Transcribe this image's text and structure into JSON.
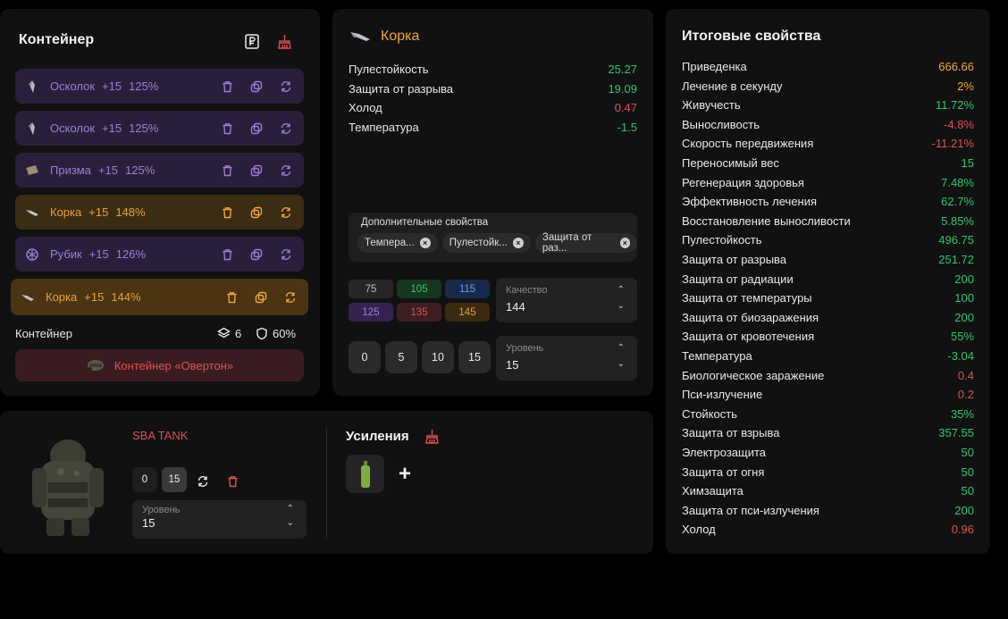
{
  "container_panel": {
    "title": "Контейнер",
    "items": [
      {
        "name": "Осколок",
        "level": "+15",
        "percent": "125%",
        "color": "purple",
        "icon": "shard-icon"
      },
      {
        "name": "Осколок",
        "level": "+15",
        "percent": "125%",
        "color": "purple",
        "icon": "shard-icon"
      },
      {
        "name": "Призма",
        "level": "+15",
        "percent": "125%",
        "color": "purple",
        "icon": "prism-icon"
      },
      {
        "name": "Корка",
        "level": "+15",
        "percent": "148%",
        "color": "orange",
        "icon": "crust-icon"
      },
      {
        "name": "Рубик",
        "level": "+15",
        "percent": "126%",
        "color": "purple",
        "icon": "rubik-icon"
      },
      {
        "name": "Корка",
        "level": "+15",
        "percent": "144%",
        "color": "orange",
        "icon": "crust-icon"
      }
    ],
    "footer": {
      "label": "Контейнер",
      "slots": "6",
      "protection": "60%"
    },
    "container_name": "Контейнер «Овертон»"
  },
  "artifact_panel": {
    "title": "Корка",
    "stats": [
      {
        "name": "Пулестойкость",
        "value": "25.27",
        "color": "green"
      },
      {
        "name": "Защита от разрыва",
        "value": "19.09",
        "color": "green"
      },
      {
        "name": "Холод",
        "value": "0.47",
        "color": "red"
      },
      {
        "name": "Температура",
        "value": "-1.5",
        "color": "green"
      }
    ],
    "extra": {
      "label": "Дополнительные свойства",
      "chips": [
        "Темпера...",
        "Пулестойк...",
        "Защита от раз..."
      ]
    },
    "quality_values": [
      "75",
      "105",
      "115",
      "125",
      "135",
      "145"
    ],
    "quality_select": {
      "label": "Качество",
      "value": "144"
    },
    "level_buttons": [
      "0",
      "5",
      "10",
      "15"
    ],
    "level_select": {
      "label": "Уровень",
      "value": "15"
    }
  },
  "armor_panel": {
    "name": "SBA TANK",
    "level_buttons": [
      "0",
      "15"
    ],
    "level_select": {
      "label": "Уровень",
      "value": "15"
    },
    "boosts_title": "Усиления",
    "add_symbol": "+"
  },
  "total_panel": {
    "title": "Итоговые свойства",
    "stats": [
      {
        "name": "Приведенка",
        "value": "666.66",
        "color": "orange"
      },
      {
        "name": "Лечение в секунду",
        "value": "2%",
        "color": "orange"
      },
      {
        "name": "Живучесть",
        "value": "11.72%",
        "color": "green"
      },
      {
        "name": "Выносливость",
        "value": "-4.8%",
        "color": "red"
      },
      {
        "name": "Скорость передвижения",
        "value": "-11.21%",
        "color": "red"
      },
      {
        "name": "Переносимый вес",
        "value": "15",
        "color": "green"
      },
      {
        "name": "Регенерация здоровья",
        "value": "7.48%",
        "color": "green"
      },
      {
        "name": "Эффективность лечения",
        "value": "62.7%",
        "color": "green"
      },
      {
        "name": "Восстановление выносливости",
        "value": "5.85%",
        "color": "green"
      },
      {
        "name": "Пулестойкость",
        "value": "496.75",
        "color": "green"
      },
      {
        "name": "Защита от разрыва",
        "value": "251.72",
        "color": "green"
      },
      {
        "name": "Защита от радиации",
        "value": "200",
        "color": "green"
      },
      {
        "name": "Защита от температуры",
        "value": "100",
        "color": "green"
      },
      {
        "name": "Защита от биозаражения",
        "value": "200",
        "color": "green"
      },
      {
        "name": "Защита от кровотечения",
        "value": "55%",
        "color": "green"
      },
      {
        "name": "Температура",
        "value": "-3.04",
        "color": "green"
      },
      {
        "name": "Биологическое заражение",
        "value": "0.4",
        "color": "red"
      },
      {
        "name": "Пси-излучение",
        "value": "0.2",
        "color": "red"
      },
      {
        "name": "Стойкость",
        "value": "35%",
        "color": "green"
      },
      {
        "name": "Защита от взрыва",
        "value": "357.55",
        "color": "green"
      },
      {
        "name": "Электрозащита",
        "value": "50",
        "color": "green"
      },
      {
        "name": "Защита от огня",
        "value": "50",
        "color": "green"
      },
      {
        "name": "Химзащита",
        "value": "50",
        "color": "green"
      },
      {
        "name": "Защита от пси-излучения",
        "value": "200",
        "color": "green"
      },
      {
        "name": "Холод",
        "value": "0.96",
        "color": "red"
      }
    ]
  },
  "colors": {
    "green": "#33c46a",
    "red": "#d9534f",
    "orange": "#f0a63c",
    "purple": "#9e7dd6"
  }
}
